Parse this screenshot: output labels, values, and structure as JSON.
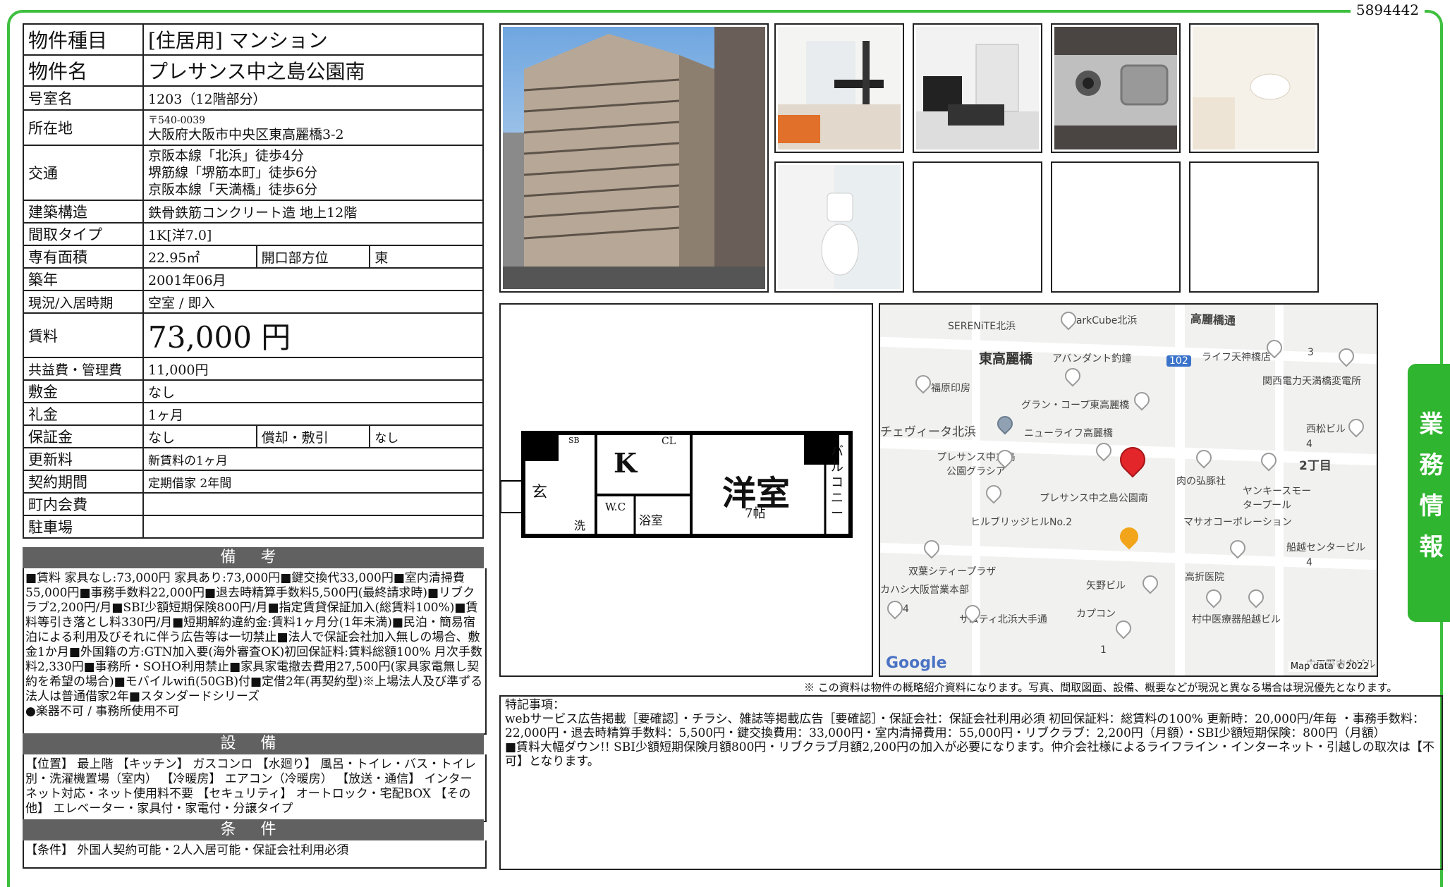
{
  "doc_id": "5894442",
  "side_tab": "業務情報",
  "property": {
    "type_label": "物件種目",
    "type_value": "[住居用] マンション",
    "name_label": "物件名",
    "name_value": "プレサンス中之島公園南",
    "room_label": "号室名",
    "room_value": "1203（12階部分）",
    "address_label": "所在地",
    "postal": "〒540-0039",
    "address": "大阪府大阪市中央区東高麗橋3-2",
    "transport_label": "交通",
    "transport_1": "京阪本線「北浜」徒歩4分",
    "transport_2": "堺筋線「堺筋本町」徒歩6分",
    "transport_3": "京阪本線「天満橋」徒歩6分",
    "structure_label": "建築構造",
    "structure_value": "鉄骨鉄筋コンクリート造 地上12階",
    "layout_label": "間取タイプ",
    "layout_value": "1K[洋7.0]",
    "area_label": "専有面積",
    "area_value": "22.95㎡",
    "direction_label": "開口部方位",
    "direction_value": "東",
    "built_label": "築年",
    "built_value": "2001年06月",
    "status_label": "現況/入居時期",
    "status_value": "空室 / 即入",
    "rent_label": "賃料",
    "rent_value": "73,000 円",
    "fee_label": "共益費・管理費",
    "fee_value": "11,000円",
    "deposit_label": "敷金",
    "deposit_value": "なし",
    "keymoney_label": "礼金",
    "keymoney_value": "1ヶ月",
    "guarantee_label": "保証金",
    "guarantee_value": "なし",
    "amort_label": "償却・敷引",
    "amort_value": "なし",
    "renewal_label": "更新料",
    "renewal_value": "新賃料の1ヶ月",
    "term_label": "契約期間",
    "term_value": "定期借家 2年間",
    "community_label": "町内会費",
    "community_value": "",
    "parking_label": "駐車場",
    "parking_value": ""
  },
  "bikou": {
    "title": "備 考",
    "text": "■賃料 家具なし:73,000円 家具あり:73,000円■鍵交換代33,000円■室内清掃費55,000円■事務手数料22,000円■退去時精算手数料5,500円(最終請求時)■リブクラブ2,200円/月■SBI少額短期保険800円/月■指定賃貸保証加入(総賃料100%)■賃料等引き落とし料330円/月■短期解約違約金:賃料1ヶ月分(1年未満)■民泊・簡易宿泊による利用及びそれに伴う広告等は一切禁止■法人で保証会社加入無しの場合、敷金1か月■外国籍の方:GTN加入要(海外審査OK)初回保証料:賃料総額100% 月次手数料2,330円■事務所・SOHO利用禁止■家具家電撤去費用27,500円(家具家電無し契約を希望の場合)■モバイルwifi(50GB)付■定借2年(再契約型)※上場法人及び準ずる法人は普通借家2年■スタンダードシリーズ",
    "note": "●楽器不可 / 事務所使用不可"
  },
  "setsubi": {
    "title": "設 備",
    "text": "【位置】 最上階 【キッチン】 ガスコンロ 【水廻り】 風呂・トイレ・バス・トイレ別・洗濯機置場（室内） 【冷暖房】 エアコン（冷暖房） 【放送・通信】 インターネット対応・ネット使用料不要 【セキュリティ】 オートロック・宅配BOX 【その他】 エレベーター・家具付・家電付・分譲タイプ"
  },
  "jouken": {
    "title": "条 件",
    "text": "【条件】 外国人契約可能・2人入居可能・保証会社利用必須"
  },
  "floorplan": {
    "room_name": "洋室",
    "room_size": "7帖",
    "kitchen": "K",
    "entrance": "玄",
    "wash": "洗",
    "wc": "W.C",
    "bath": "浴室",
    "sb": "SB",
    "cl": "CL",
    "balcony": "バルコニー"
  },
  "map": {
    "labels": [
      "SERENiTE北浜",
      "ParkCube北浜",
      "高麗橋通",
      "東高麗橋",
      "アバンダント釣鐘",
      "ライフ天神橋店",
      "3",
      "関西電力天満橋変電所",
      "福原印房",
      "102",
      "グラン・コープ東高麗橋",
      "チェヴィータ北浜",
      "ニューライフ高麗橋",
      "西松ビル",
      "4",
      "プレサンス中之島公園グラシア",
      "2丁目",
      "肉の弘豚社",
      "ヤンキースモータープール",
      "プレサンス中之島公園南",
      "ヒルブリッジヒルNo.2",
      "マサオコーポレーション",
      "船越センタービル",
      "4",
      "双葉シティープラザ",
      "高折医院",
      "カハシ大阪営業本部",
      "矢野ビル",
      "4",
      "サムティ北浜大手通",
      "カプコン",
      "村中医療器船越ビル",
      "1",
      "内平野中央ビル"
    ],
    "google": "Google",
    "credit": "Map data ©2022"
  },
  "disclaimer": "※ この資料は物件の概略紹介資料になります。写真、間取図面、設備、概要などが現況と異なる場合は現況優先となります。",
  "remarks": {
    "title": "特記事項：",
    "line1": "webサービス広告掲載［要確認］・チラシ、雑誌等掲載広告［要確認］・保証会社：保証会社利用必須 初回保証料：総賃料の100% 更新時：20,000円/年毎 ・事務手数料：22,000円・退去時精算手数料：5,500円・鍵交換費用：33,000円・室内清掃費用：55,000円・リブクラブ：2,200円（月額）・SBI少額短期保険：800円（月額）",
    "line2": "■賃料大幅ダウン!! SBI少額短期保険月額800円・リブクラブ月額2,200円の加入が必要になります。仲介会社様によるライフライン・インターネット・引越しの取次は【不可】となります。"
  }
}
